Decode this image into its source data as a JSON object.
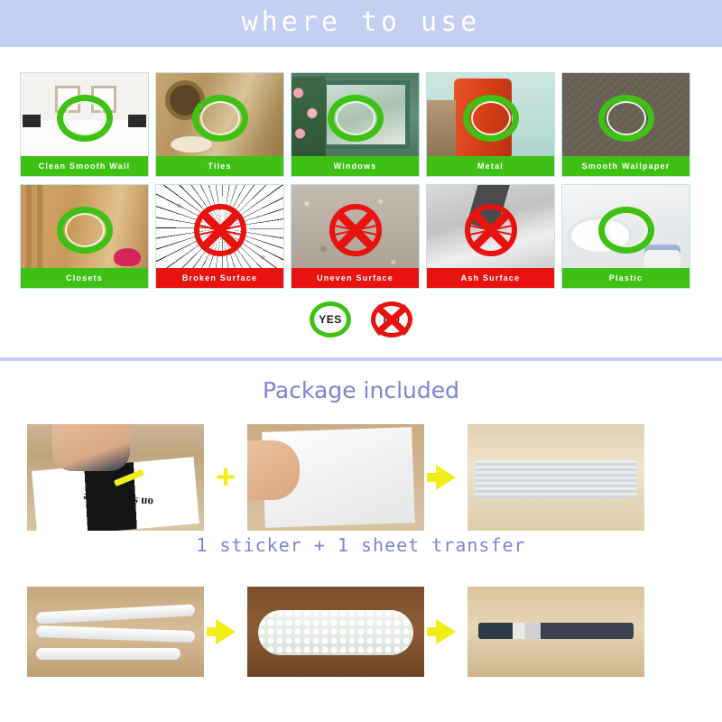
{
  "header": {
    "title": "where to use"
  },
  "surfaces": {
    "row1": [
      {
        "label": "Clean Smooth Wall",
        "status": "ok",
        "photo": "bedroom-wall-photo"
      },
      {
        "label": "Tiles",
        "status": "ok",
        "photo": "bathroom-tiles-photo"
      },
      {
        "label": "Windows",
        "status": "ok",
        "photo": "window-exterior-photo"
      },
      {
        "label": "Metal",
        "status": "ok",
        "photo": "metal-fridge-photo"
      },
      {
        "label": "Smooth Wallpaper",
        "status": "ok",
        "photo": "wallpaper-texture-photo"
      }
    ],
    "row2": [
      {
        "label": "Closets",
        "status": "ok",
        "photo": "wooden-closet-photo"
      },
      {
        "label": "Broken Surface",
        "status": "no",
        "photo": "broken-glass-photo"
      },
      {
        "label": "Uneven Surface",
        "status": "no",
        "photo": "rough-stucco-photo"
      },
      {
        "label": "Ash Surface",
        "status": "no",
        "photo": "ash-dusty-surface-photo"
      },
      {
        "label": "Plastic",
        "status": "ok",
        "photo": "plastic-toilet-photo"
      }
    ]
  },
  "legend": {
    "yes_label": "YES",
    "no_label": "NO"
  },
  "package": {
    "title": "Package included",
    "caption": "1 sticker + 1 sheet transfer",
    "plus_symbol": "+",
    "row1": [
      {
        "name": "sticker-application-photo"
      },
      {
        "name": "transfer-sheet-photo"
      },
      {
        "name": "rolled-film-photo"
      }
    ],
    "row2": [
      {
        "name": "rolled-strips-photo"
      },
      {
        "name": "bubble-wrapped-roll-photo"
      },
      {
        "name": "packed-tube-photo"
      }
    ],
    "sticker_art_text": "on s'embrasse"
  },
  "colors": {
    "banner": "#c4cff3",
    "ok_green": "#3fc014",
    "no_red": "#e8120e",
    "accent_blue": "#7b85d4",
    "arrow_yellow": "#f2ed18"
  }
}
